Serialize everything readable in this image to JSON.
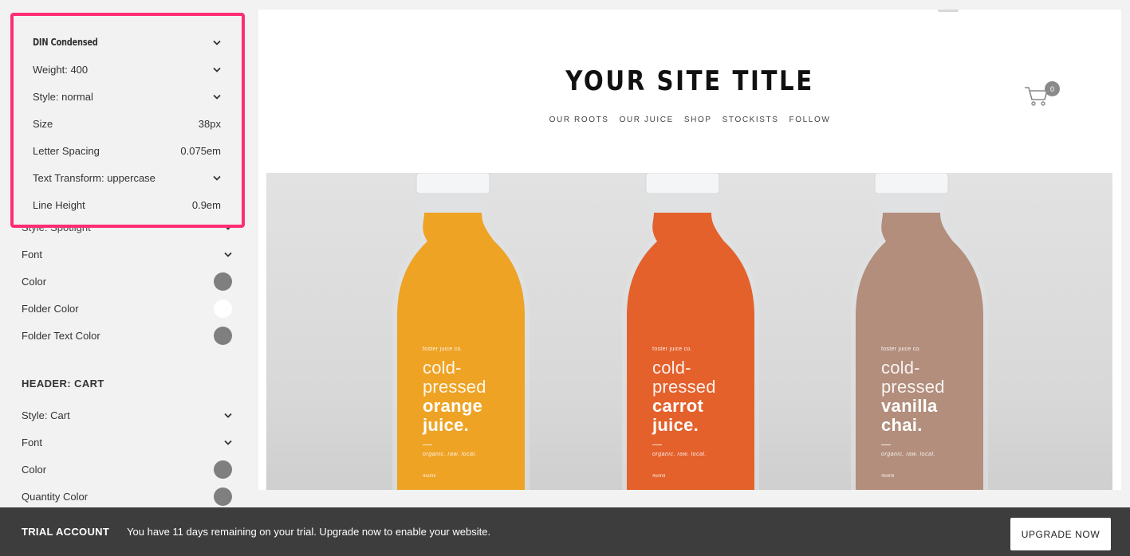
{
  "font_popover": {
    "font_name": "DIN Condensed",
    "weight": "Weight: 400",
    "style": "Style: normal",
    "size_label": "Size",
    "size_value": "38px",
    "letter_spacing_label": "Letter Spacing",
    "letter_spacing_value": "0.075em",
    "text_transform": "Text Transform: uppercase",
    "line_height_label": "Line Height",
    "line_height_value": "0.9em"
  },
  "sidebar": {
    "partial_row": "Style: Spotlight",
    "navigation_rows": [
      {
        "label": "Font",
        "control": "chevron-down-icon"
      },
      {
        "label": "Color",
        "control": "swatch",
        "color": "#7f7f7f"
      },
      {
        "label": "Folder Color",
        "control": "swatch",
        "color": "#ffffff"
      },
      {
        "label": "Folder Text Color",
        "control": "swatch",
        "color": "#7f7f7f"
      }
    ],
    "cart_section_title": "HEADER: CART",
    "cart_rows": [
      {
        "label": "Style: Cart",
        "control": "chevron-down-icon"
      },
      {
        "label": "Font",
        "control": "chevron-down-icon"
      },
      {
        "label": "Color",
        "control": "swatch",
        "color": "#7f7f7f"
      },
      {
        "label": "Quantity Color",
        "control": "swatch",
        "color": "#7f7f7f"
      }
    ]
  },
  "preview": {
    "site_title": "YOUR SITE TITLE",
    "nav": [
      "OUR ROOTS",
      "OUR JUICE",
      "SHOP",
      "STOCKISTS",
      "FOLLOW"
    ],
    "cart_count": "0",
    "bottles": [
      {
        "brand": "foster juice co.",
        "line1": "cold-",
        "line2": "pressed",
        "line3": "orange",
        "line4": "juice.",
        "tag": "organic. raw. local.",
        "volume": "450ml",
        "juice_color": "#eea325"
      },
      {
        "brand": "foster juice co.",
        "line1": "cold-",
        "line2": "pressed",
        "line3": "carrot",
        "line4": "juice.",
        "tag": "organic. raw. local.",
        "volume": "450ml",
        "juice_color": "#e4612c"
      },
      {
        "brand": "foster juice co.",
        "line1": "cold-",
        "line2": "pressed",
        "line3": "vanilla",
        "line4": "chai.",
        "tag": "organic. raw. local.",
        "volume": "450ml",
        "juice_color": "#b38e7c"
      }
    ]
  },
  "trial_bar": {
    "title": "TRIAL ACCOUNT",
    "message": "You have 11 days remaining on your trial. Upgrade now to enable your website.",
    "button": "UPGRADE NOW"
  },
  "colors": {
    "highlight": "#ff2d74",
    "trial_bar_bg": "#3d3d3d",
    "swatch_gray": "#7f7f7f"
  }
}
